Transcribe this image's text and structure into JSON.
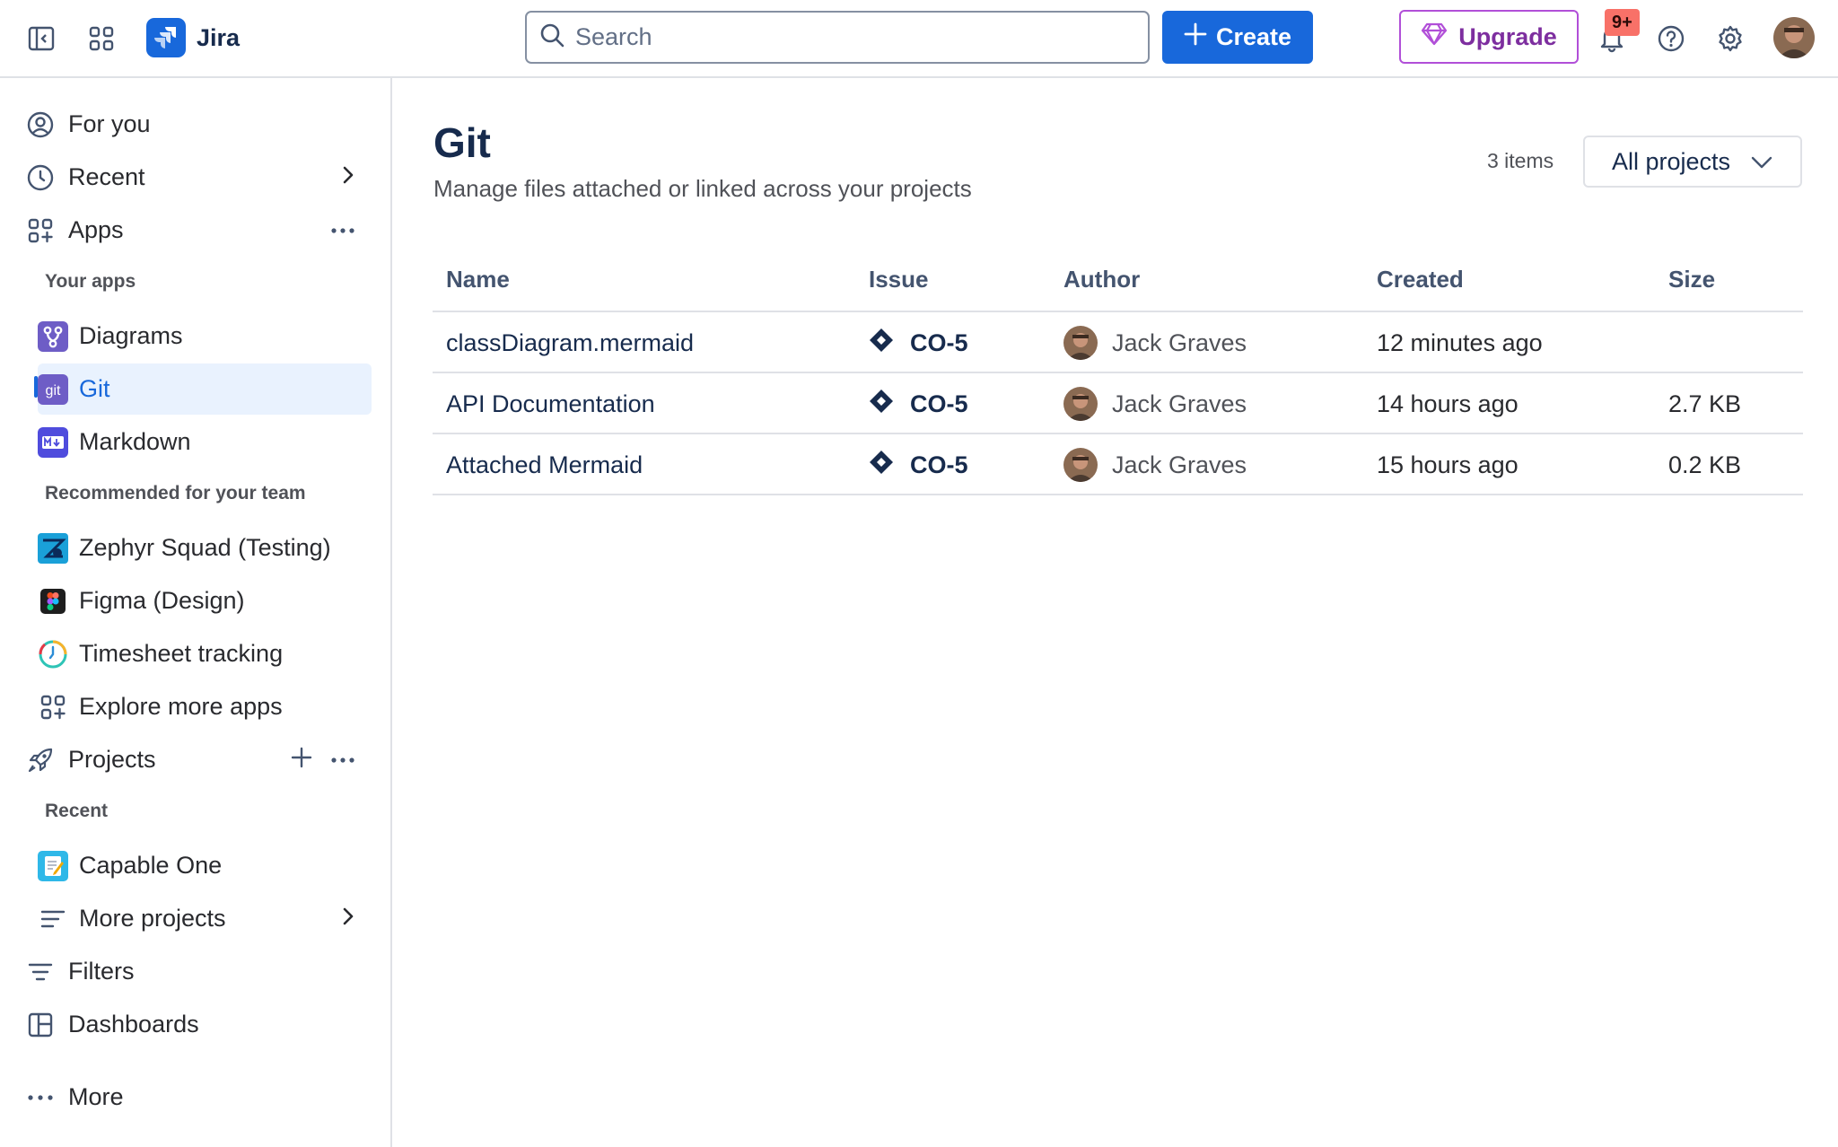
{
  "topbar": {
    "app_name": "Jira",
    "search_placeholder": "Search",
    "create_label": "Create",
    "upgrade_label": "Upgrade",
    "notifications_badge": "9+",
    "icons": [
      "sidebar-toggle-icon",
      "app-switcher-icon",
      "jira-logo",
      "search-icon",
      "plus-icon",
      "diamond-icon",
      "bell-icon",
      "help-icon",
      "settings-icon"
    ]
  },
  "sidebar": {
    "for_you": "For you",
    "recent": "Recent",
    "apps": "Apps",
    "your_apps_heading": "Your apps",
    "your_apps": [
      {
        "label": "Diagrams",
        "icon": "diagrams-app-icon"
      },
      {
        "label": "Git",
        "icon": "git-app-icon",
        "active": true
      },
      {
        "label": "Markdown",
        "icon": "markdown-app-icon"
      }
    ],
    "recommended_heading": "Recommended for your team",
    "recommended": [
      {
        "label": "Zephyr Squad (Testing)",
        "icon": "zephyr-icon"
      },
      {
        "label": "Figma (Design)",
        "icon": "figma-icon"
      },
      {
        "label": "Timesheet tracking",
        "icon": "timesheet-icon"
      },
      {
        "label": "Explore more apps",
        "icon": "apps-grid-icon"
      }
    ],
    "projects": "Projects",
    "projects_recent_heading": "Recent",
    "recent_projects": [
      {
        "label": "Capable One",
        "icon": "project-notepad-icon"
      }
    ],
    "more_projects": "More projects",
    "filters": "Filters",
    "dashboards": "Dashboards",
    "more": "More"
  },
  "main": {
    "title": "Git",
    "subtitle": "Manage files attached or linked across your projects",
    "items_count": "3 items",
    "project_filter": "All projects",
    "columns": [
      "Name",
      "Issue",
      "Author",
      "Created",
      "Size"
    ],
    "rows": [
      {
        "name": "classDiagram.mermaid",
        "issue": "CO-5",
        "author": "Jack Graves",
        "created": "12 minutes ago",
        "size": ""
      },
      {
        "name": "API Documentation",
        "issue": "CO-5",
        "author": "Jack Graves",
        "created": "14 hours ago",
        "size": "2.7 KB"
      },
      {
        "name": "Attached Mermaid",
        "issue": "CO-5",
        "author": "Jack Graves",
        "created": "15 hours ago",
        "size": "0.2 KB"
      }
    ]
  },
  "colors": {
    "brand_blue": "#1868db",
    "upgrade_purple": "#b14fd8",
    "badge_red": "#f87168",
    "active_bg": "#e9f2fe"
  }
}
